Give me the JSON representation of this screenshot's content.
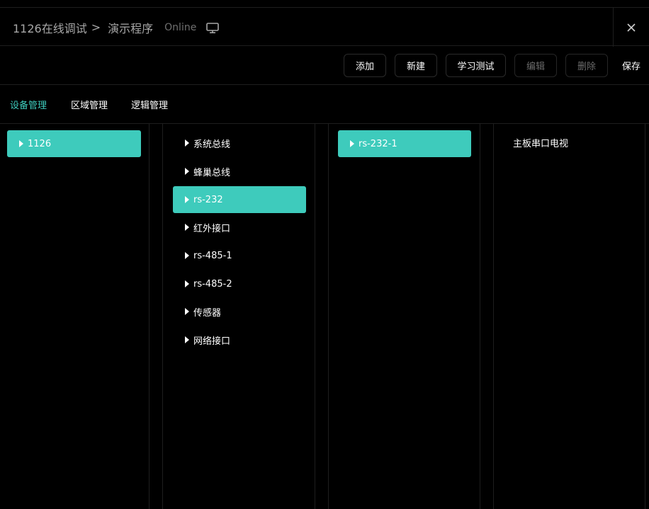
{
  "header": {
    "device": "1126在线调试",
    "separator": ">",
    "program": "演示程序",
    "status": "Online"
  },
  "toolbar": {
    "add": "添加",
    "new": "新建",
    "learn_test": "学习测试",
    "edit": "编辑",
    "delete": "删除",
    "save": "保存"
  },
  "tabs": [
    "设备管理",
    "区域管理",
    "逻辑管理"
  ],
  "columns": {
    "devices": [
      "1126"
    ],
    "interfaces": [
      "系统总线",
      "蜂巢总线",
      "rs-232",
      "红外接口",
      "rs-485-1",
      "rs-485-2",
      "传感器",
      "网络接口"
    ],
    "ports": [
      "rs-232-1"
    ],
    "endpoints": [
      "主板串口电视"
    ]
  },
  "colors": {
    "accent": "#3ecbbc",
    "background": "#000000",
    "border": "#1e1e1e",
    "muted": "#a7a7a7"
  }
}
